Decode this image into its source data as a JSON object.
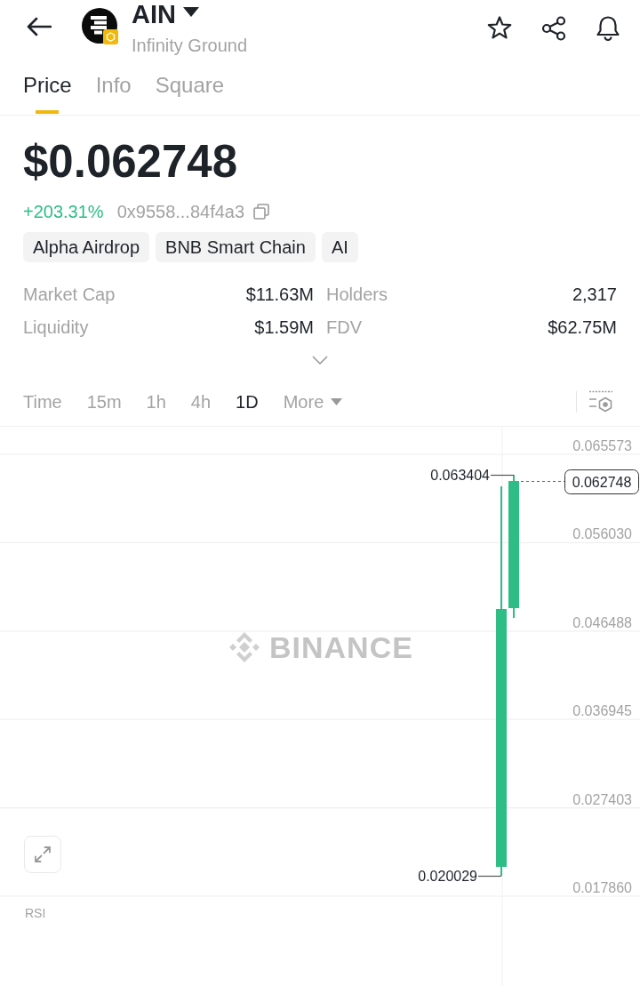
{
  "token": {
    "symbol": "AIN",
    "name": "Infinity Ground"
  },
  "tabs": [
    {
      "label": "Price",
      "selected": true
    },
    {
      "label": "Info",
      "selected": false
    },
    {
      "label": "Square",
      "selected": false
    }
  ],
  "price": "$0.062748",
  "change": "+203.31%",
  "contract_address": "0x9558...84f4a3",
  "tags": [
    "Alpha Airdrop",
    "BNB Smart Chain",
    "AI"
  ],
  "stats": [
    {
      "label": "Market Cap",
      "value": "$11.63M"
    },
    {
      "label": "Holders",
      "value": "2,317"
    },
    {
      "label": "Liquidity",
      "value": "$1.59M"
    },
    {
      "label": "FDV",
      "value": "$62.75M"
    }
  ],
  "intervals": [
    {
      "label": "Time",
      "kind": "option",
      "selected": false
    },
    {
      "label": "15m",
      "kind": "option",
      "selected": false
    },
    {
      "label": "1h",
      "kind": "option",
      "selected": false
    },
    {
      "label": "4h",
      "kind": "option",
      "selected": false
    },
    {
      "label": "1D",
      "kind": "option",
      "selected": true
    },
    {
      "label": "More",
      "kind": "dropdown",
      "selected": false
    }
  ],
  "chart": {
    "watermark": "BINANCE",
    "price_axis": [
      "0.065573",
      "0.056030",
      "0.046488",
      "0.036945",
      "0.027403",
      "0.017860"
    ],
    "high_label": "0.063404",
    "low_label": "0.020029",
    "last_price": "0.062748"
  },
  "indicator_pane": {
    "label": "RSI"
  }
}
